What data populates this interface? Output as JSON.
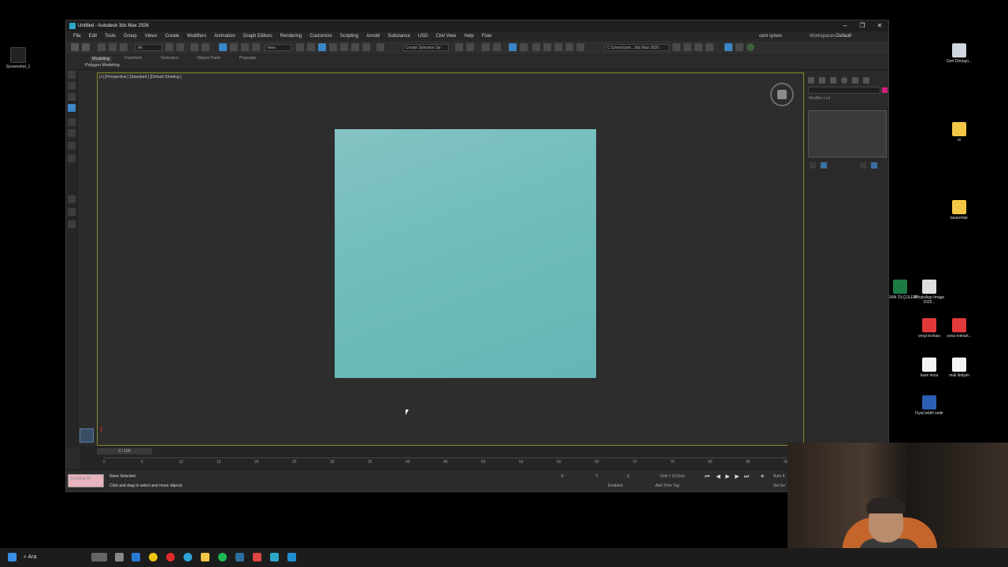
{
  "window": {
    "title": "Untitled - Autodesk 3ds Max 2026",
    "controls": [
      "–",
      "❐",
      "✕"
    ]
  },
  "menu": {
    "items": [
      "File",
      "Edit",
      "Tools",
      "Group",
      "Views",
      "Create",
      "Modifiers",
      "Animation",
      "Graph Editors",
      "Rendering",
      "Customize",
      "Scripting",
      "Arnold",
      "Substance",
      "USD",
      "Civil View",
      "Help",
      "Flow"
    ],
    "user": "cem işmen",
    "workspaces_label": "Workspaces:",
    "workspace_value": "Default"
  },
  "toolbar": {
    "selection_filter": "All",
    "view_dropdown": "View",
    "create_selection_set": "Create Selection Se",
    "project_path": "C:\\Users\\cem...3ds Max 2026"
  },
  "ribbon": {
    "tabs": [
      "Modeling",
      "Freeform",
      "Selection",
      "Object Paint",
      "Populate"
    ],
    "subtab": "Polygon Modeling"
  },
  "viewport": {
    "label": "[+] [Perspective ] [Standard ] [Default Shading ]",
    "plane_color": "#6fbdbc"
  },
  "command_panel": {
    "modifier_list": "Modifier List",
    "color_swatch": "#d61f7a"
  },
  "timeline": {
    "frame_readout": "0 / 100",
    "ticks": [
      "0",
      "5",
      "10",
      "15",
      "20",
      "25",
      "30",
      "35",
      "40",
      "45",
      "50",
      "55",
      "60",
      "65",
      "70",
      "75",
      "80",
      "85",
      "90"
    ]
  },
  "status": {
    "maxscript": "Scripting Mi",
    "selection": "None Selected",
    "prompt": "Click and drag to select and move objects",
    "x_label": "X:",
    "y_label": "Y:",
    "z_label": "Z:",
    "grid": "Grid = 10,0cm",
    "enabled": "Enabled:",
    "add_time_tag": "Add Time Tag",
    "auto_key": "Auto K",
    "set_key": "Set Ke"
  },
  "desktop": {
    "left_icon": "Screenshot_1",
    "icons": [
      {
        "label": "Geri Dönüşü...",
        "kind": "recycle-bin-icon"
      },
      {
        "label": "st",
        "kind": "folder-icon"
      },
      {
        "label": "tasarımlar",
        "kind": "folder-icon"
      },
      {
        "label": "EKRAN ÖLÇÜLERİ",
        "kind": "excel-icon"
      },
      {
        "label": "WhatsApp Image 2025...",
        "kind": "image-icon"
      },
      {
        "label": "vergi levhası",
        "kind": "pdf-icon"
      },
      {
        "label": "sona mimarl...",
        "kind": "pdf-icon"
      },
      {
        "label": "kase imza",
        "kind": "image-icon"
      },
      {
        "label": "mail iletişim",
        "kind": "document-icon"
      },
      {
        "label": "Fiyat teklifi sedir",
        "kind": "word-icon"
      }
    ]
  },
  "taskbar": {
    "search": "Ara"
  }
}
